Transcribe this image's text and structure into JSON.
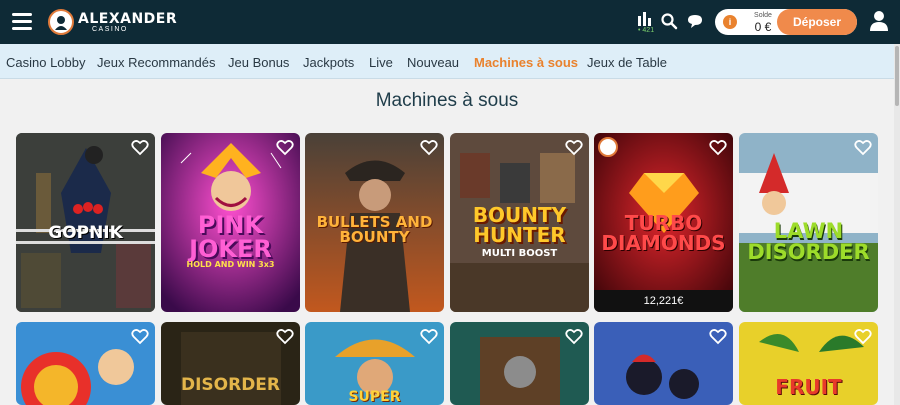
{
  "header": {
    "logo_main": "ALEXANDER",
    "logo_sub": "CASINO",
    "online_count": "421",
    "wallet": {
      "label": "Solde",
      "amount": "0 €",
      "deposit_label": "Déposer"
    }
  },
  "nav": {
    "items": [
      {
        "label": "Casino Lobby",
        "active": false
      },
      {
        "label": "Jeux Recommandés",
        "active": false
      },
      {
        "label": "Jeu Bonus",
        "active": false
      },
      {
        "label": "Jackpots",
        "active": false
      },
      {
        "label": "Live",
        "active": false
      },
      {
        "label": "Nouveau",
        "active": false
      },
      {
        "label": "Machines à sous",
        "active": true
      },
      {
        "label": "Jeux de Table",
        "active": false
      }
    ]
  },
  "section": {
    "title": "Machines à sous"
  },
  "games": [
    {
      "title": "GOPNIK",
      "jackpot": null
    },
    {
      "title": "PINK JOKER",
      "subtitle": "HOLD AND WIN 3x3",
      "jackpot": null
    },
    {
      "title": "BULLETS AND BOUNTY",
      "jackpot": null
    },
    {
      "title": "BOUNTY HUNTER",
      "subtitle": "MULTI BOOST",
      "jackpot": null
    },
    {
      "title": "TURBO DIAMONDS",
      "jackpot": "12,221€"
    },
    {
      "title": "LAWN DISORDER",
      "jackpot": null
    },
    {
      "title": "",
      "jackpot": null
    },
    {
      "title": "DISORDER",
      "jackpot": null
    },
    {
      "title": "SUPER",
      "jackpot": null
    },
    {
      "title": "",
      "jackpot": null
    },
    {
      "title": "",
      "jackpot": null
    },
    {
      "title": "FRUIT",
      "jackpot": null
    }
  ],
  "colors": {
    "header_bg": "#0e2a36",
    "accent": "#e9822e",
    "nav_bg": "#deeef8",
    "page_bg": "#f1f1f1"
  }
}
